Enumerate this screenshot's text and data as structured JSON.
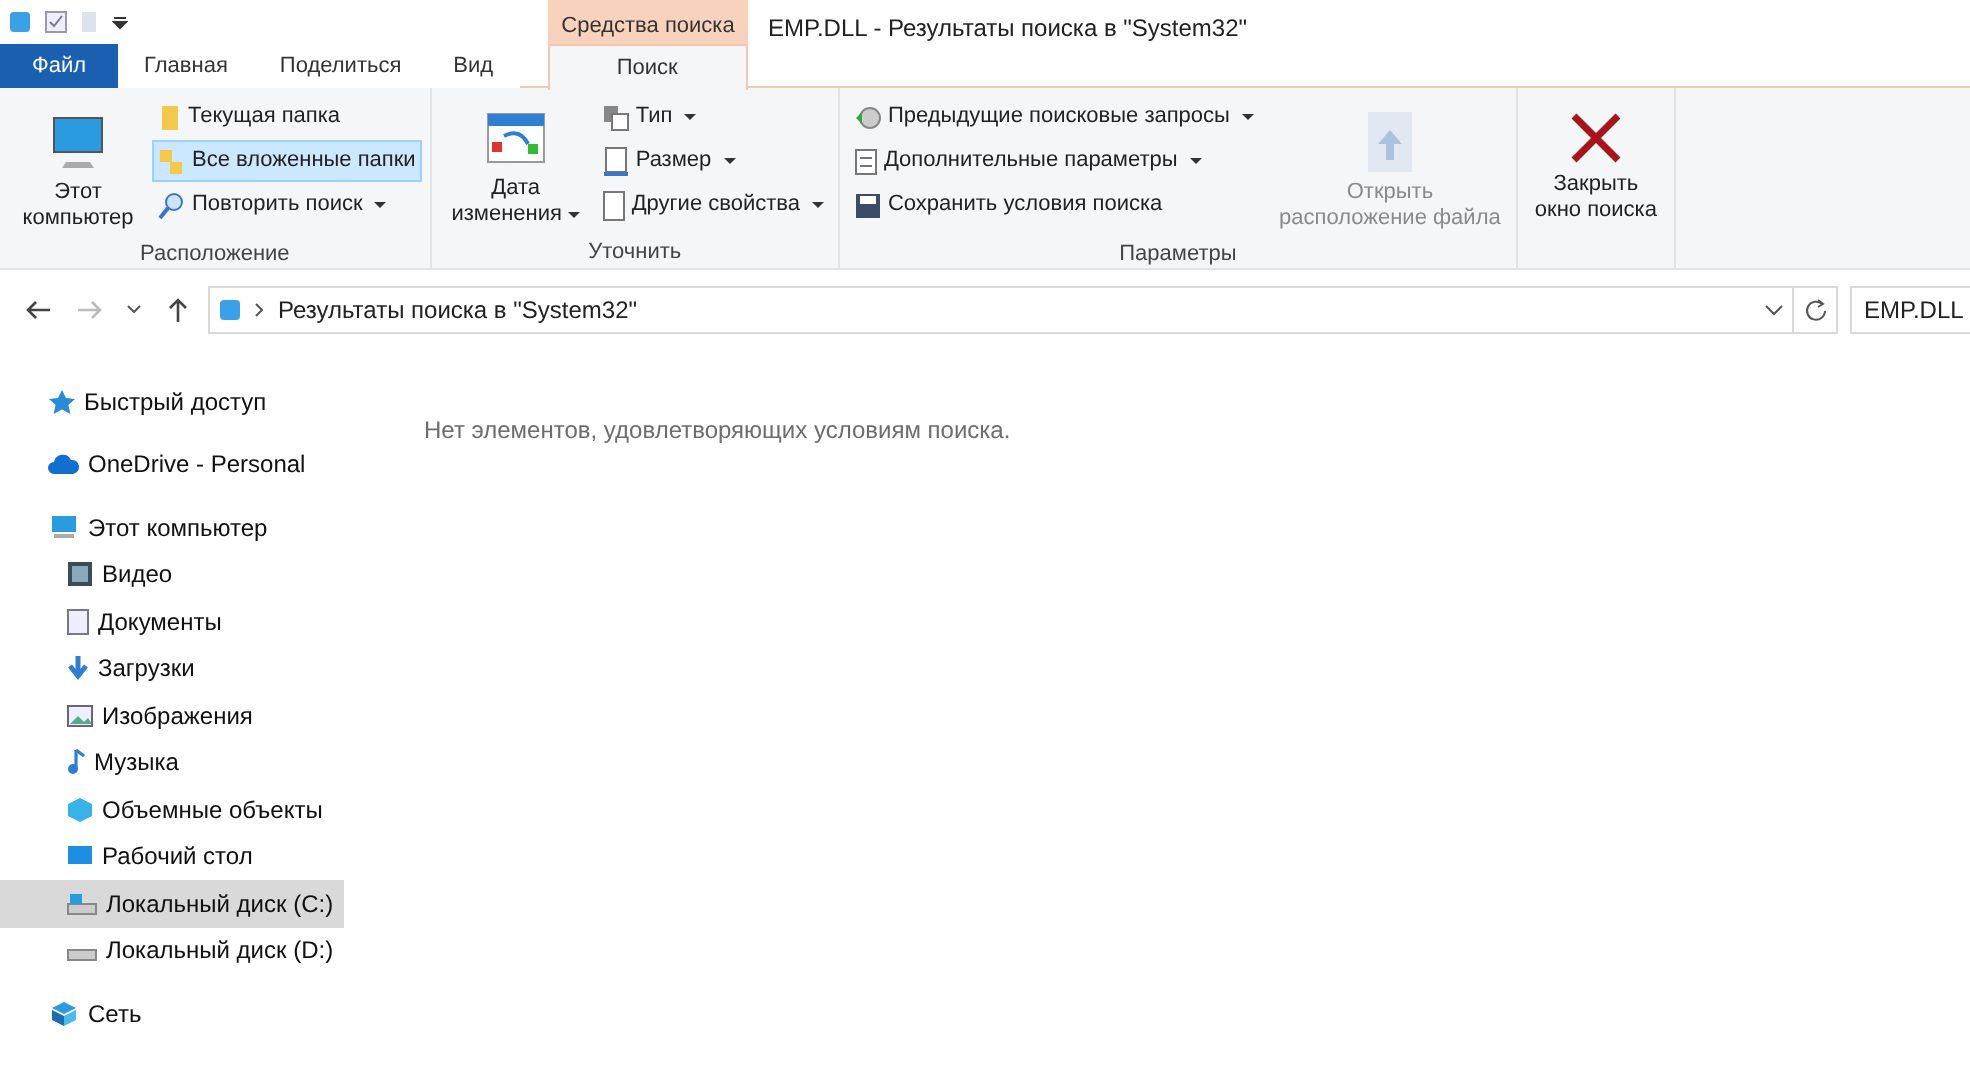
{
  "title_bar": {
    "title": "EMP.DLL - Результаты поиска в \"System32\""
  },
  "tool_tab_header": "Средства поиска",
  "tabs": [
    {
      "label": "Файл",
      "kind": "file",
      "selected": false
    },
    {
      "label": "Главная",
      "kind": "normal",
      "selected": false
    },
    {
      "label": "Поделиться",
      "kind": "normal",
      "selected": false
    },
    {
      "label": "Вид",
      "kind": "normal",
      "selected": false
    },
    {
      "label": "Поиск",
      "kind": "tool",
      "selected": true
    }
  ],
  "ribbon": {
    "groups": [
      {
        "label": "Расположение",
        "items": [
          {
            "label": "Этот компьютер",
            "kind": "large",
            "dropdown": false,
            "disabled": false,
            "selected": false
          },
          {
            "label": "Текущая папка",
            "kind": "small",
            "dropdown": false,
            "disabled": false,
            "selected": false
          },
          {
            "label": "Все вложенные папки",
            "kind": "small",
            "dropdown": false,
            "disabled": false,
            "selected": true
          },
          {
            "label": "Повторить поиск",
            "kind": "small",
            "dropdown": true,
            "disabled": false,
            "selected": false
          }
        ]
      },
      {
        "label": "Уточнить",
        "items": [
          {
            "label": "Дата изменения",
            "kind": "large",
            "dropdown": true,
            "disabled": false,
            "selected": false
          },
          {
            "label": "Тип",
            "kind": "small",
            "dropdown": true,
            "disabled": false,
            "selected": false
          },
          {
            "label": "Размер",
            "kind": "small",
            "dropdown": true,
            "disabled": false,
            "selected": false
          },
          {
            "label": "Другие свойства",
            "kind": "small",
            "dropdown": true,
            "disabled": false,
            "selected": false
          }
        ]
      },
      {
        "label": "Параметры",
        "items": [
          {
            "label": "Предыдущие поисковые запросы",
            "kind": "small",
            "dropdown": true,
            "disabled": false,
            "selected": false
          },
          {
            "label": "Дополнительные параметры",
            "kind": "small",
            "dropdown": true,
            "disabled": false,
            "selected": false
          },
          {
            "label": "Сохранить условия поиска",
            "kind": "small",
            "dropdown": false,
            "disabled": false,
            "selected": false
          },
          {
            "label": "Открыть расположение файла",
            "kind": "large",
            "dropdown": false,
            "disabled": true,
            "selected": false
          }
        ]
      },
      {
        "items": [
          {
            "label": "Закрыть окно поиска",
            "kind": "large",
            "dropdown": false,
            "disabled": false,
            "selected": false
          }
        ]
      }
    ]
  },
  "address_bar": {
    "path": "Результаты поиска в \"System32\"",
    "search_value": "EMP.DLL"
  },
  "sidebar": {
    "items": [
      {
        "label": "Быстрый доступ",
        "selected": false
      },
      {
        "label": "OneDrive - Personal",
        "selected": false
      },
      {
        "label": "Этот компьютер",
        "selected": false,
        "children": [
          {
            "label": "Видео",
            "selected": false
          },
          {
            "label": "Документы",
            "selected": false
          },
          {
            "label": "Загрузки",
            "selected": false
          },
          {
            "label": "Изображения",
            "selected": false
          },
          {
            "label": "Музыка",
            "selected": false
          },
          {
            "label": "Объемные объекты",
            "selected": false
          },
          {
            "label": "Рабочий стол",
            "selected": false
          },
          {
            "label": "Локальный диск (C:)",
            "selected": true
          },
          {
            "label": "Локальный диск (D:)",
            "selected": false
          }
        ]
      },
      {
        "label": "Сеть",
        "selected": false
      }
    ]
  },
  "content": {
    "empty_message": "Нет элементов, удовлетворяющих условиям поиска."
  }
}
